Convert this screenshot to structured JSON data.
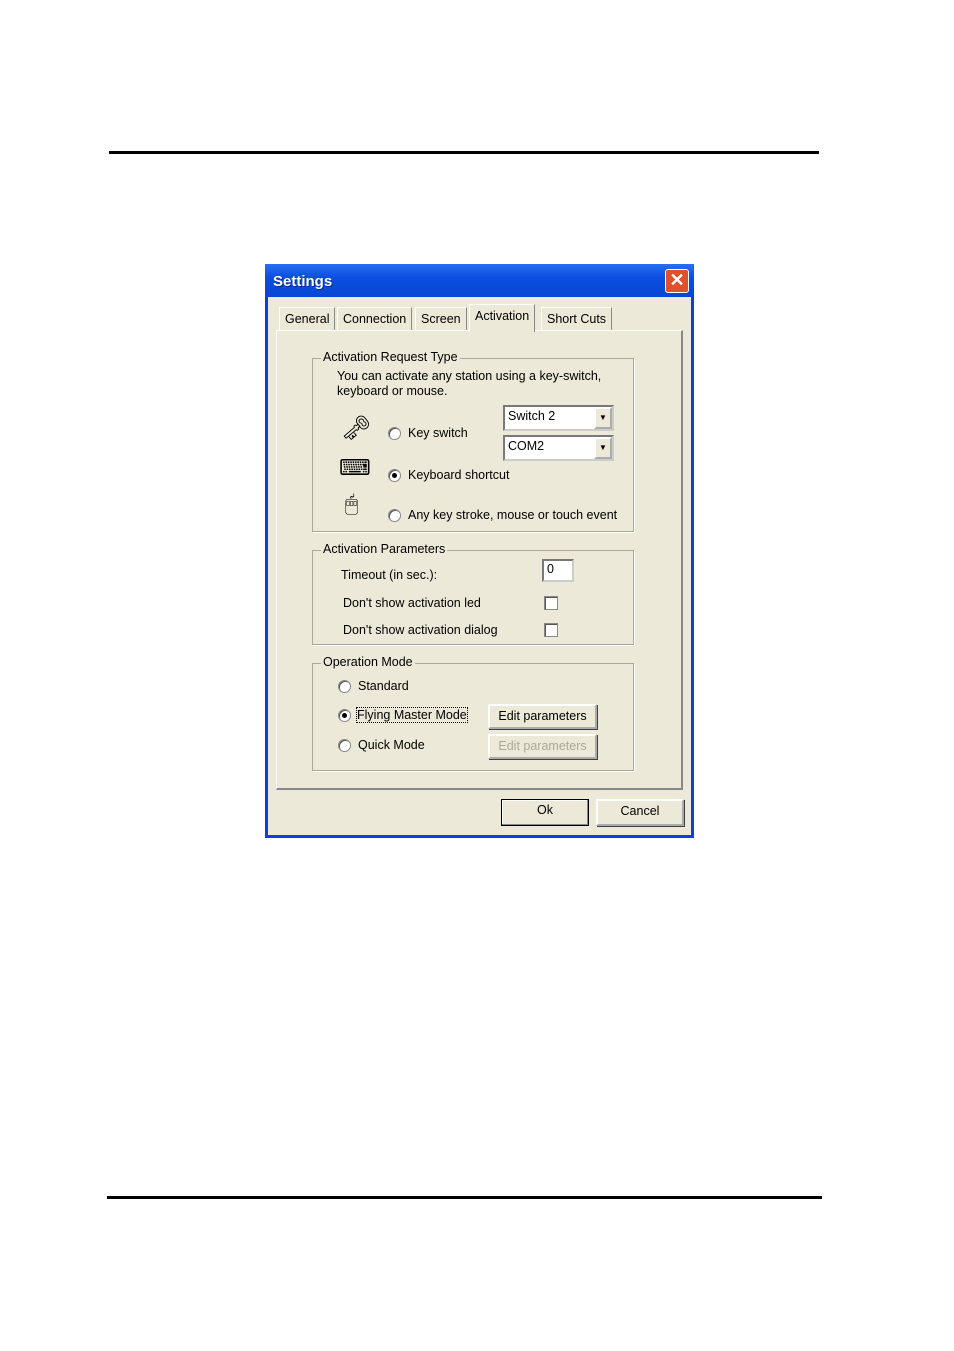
{
  "dialog": {
    "title": "Settings",
    "tabs": [
      "General",
      "Connection",
      "Screen",
      "Activation",
      "Short Cuts"
    ],
    "active_tab": "Activation",
    "request_type": {
      "legend": "Activation Request Type",
      "description": "You can activate any station using a key-switch, keyboard or mouse.",
      "options": [
        {
          "label": "Key switch",
          "selected": false,
          "icon": "key-switch-icon"
        },
        {
          "label": "Keyboard shortcut",
          "selected": true,
          "icon": "keyboard-icon"
        },
        {
          "label": "Any key stroke, mouse or touch event",
          "selected": false,
          "icon": "mouse-icon"
        }
      ],
      "switch_select": "Switch 2",
      "port_select": "COM2"
    },
    "parameters": {
      "legend": "Activation Parameters",
      "timeout_label": "Timeout (in sec.):",
      "timeout_value": "0",
      "no_led_label": "Don't show activation led",
      "no_led_checked": false,
      "no_dialog_label": "Don't show activation dialog",
      "no_dialog_checked": false
    },
    "operation_mode": {
      "legend": "Operation Mode",
      "options": [
        {
          "label": "Standard",
          "selected": false
        },
        {
          "label": "Flying Master Mode",
          "selected": true
        },
        {
          "label": "Quick Mode",
          "selected": false
        }
      ],
      "edit_label": "Edit parameters",
      "edit_disabled_label": "Edit parameters"
    },
    "ok_label": "Ok",
    "cancel_label": "Cancel"
  }
}
